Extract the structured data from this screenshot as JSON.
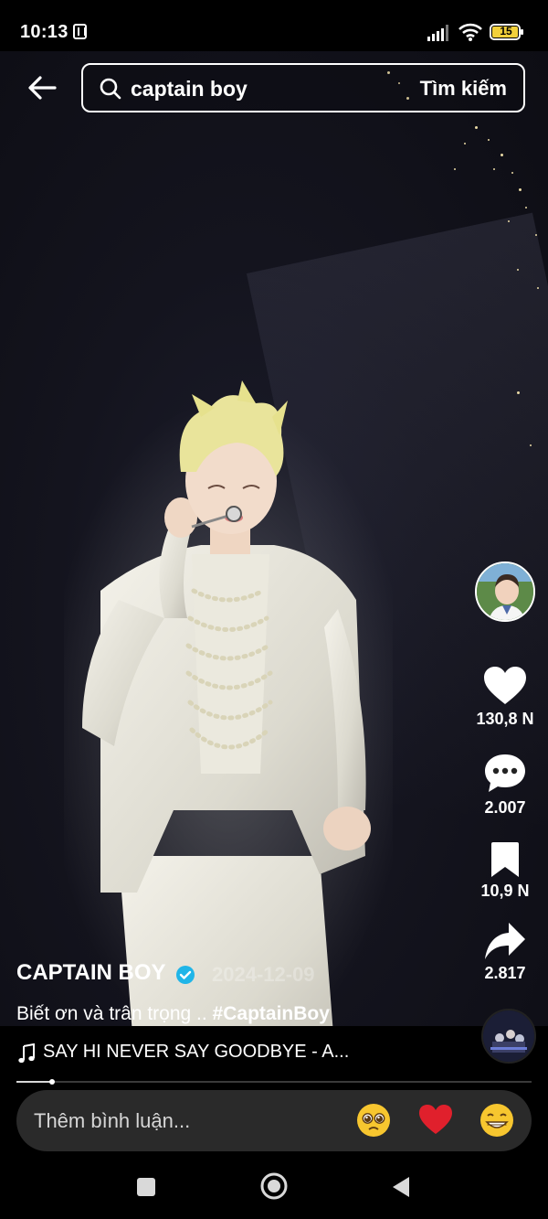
{
  "status_bar": {
    "time": "10:13",
    "battery": "15"
  },
  "search": {
    "query": "captain boy",
    "submit_label": "Tìm kiếm"
  },
  "actions": {
    "likes": "130,8 N",
    "comments": "2.007",
    "saves": "10,9 N",
    "shares": "2.817"
  },
  "post": {
    "author": "CAPTAIN BOY",
    "date": "2024-12-09",
    "caption_text": "Biết ơn và trân trọng .. ",
    "hashtag": "#CaptainBoy",
    "music": "SAY HI NEVER SAY GOODBYE - A..."
  },
  "video_progress": 0.07,
  "comment": {
    "placeholder": "Thêm bình luận..."
  },
  "quick_reactions": [
    "pleading-face",
    "red-heart",
    "grinning-face"
  ],
  "colors": {
    "accent_verified": "#20b5e8",
    "heart": "#e0202c",
    "emoji_yellow": "#f7c62f"
  }
}
